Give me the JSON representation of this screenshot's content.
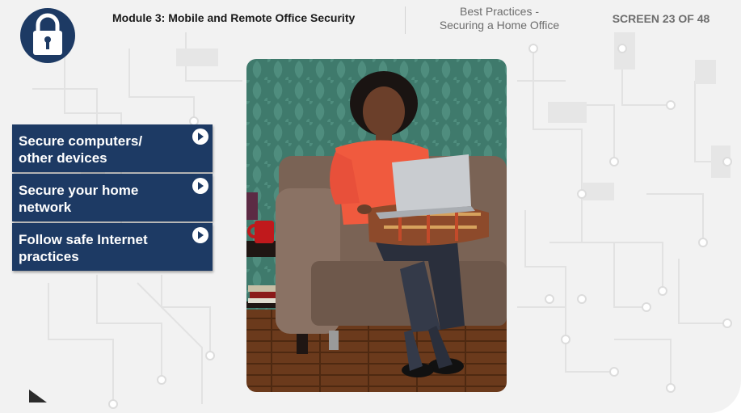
{
  "header": {
    "module_title": "Module 3: Mobile and Remote Office Security",
    "section_line1": "Best Practices -",
    "section_line2": "Securing a Home Office",
    "screen_counter": "SCREEN 23 OF 48"
  },
  "menu": {
    "items": [
      {
        "line1": "Secure computers/",
        "line2": "other devices"
      },
      {
        "line1": "Secure your home",
        "line2": "network"
      },
      {
        "line1": "Follow safe Internet",
        "line2": "practices"
      }
    ]
  },
  "icons": {
    "logo": "padlock-icon",
    "menu_arrow": "arrow-right-circle-icon",
    "corner": "corner-triangle-icon"
  },
  "colors": {
    "menu_bg": "#1d3a64",
    "logo_bg": "#1d3a64",
    "background": "#f2f2f2",
    "text_dark": "#1a1a1a",
    "text_gray": "#6d6d6d"
  }
}
